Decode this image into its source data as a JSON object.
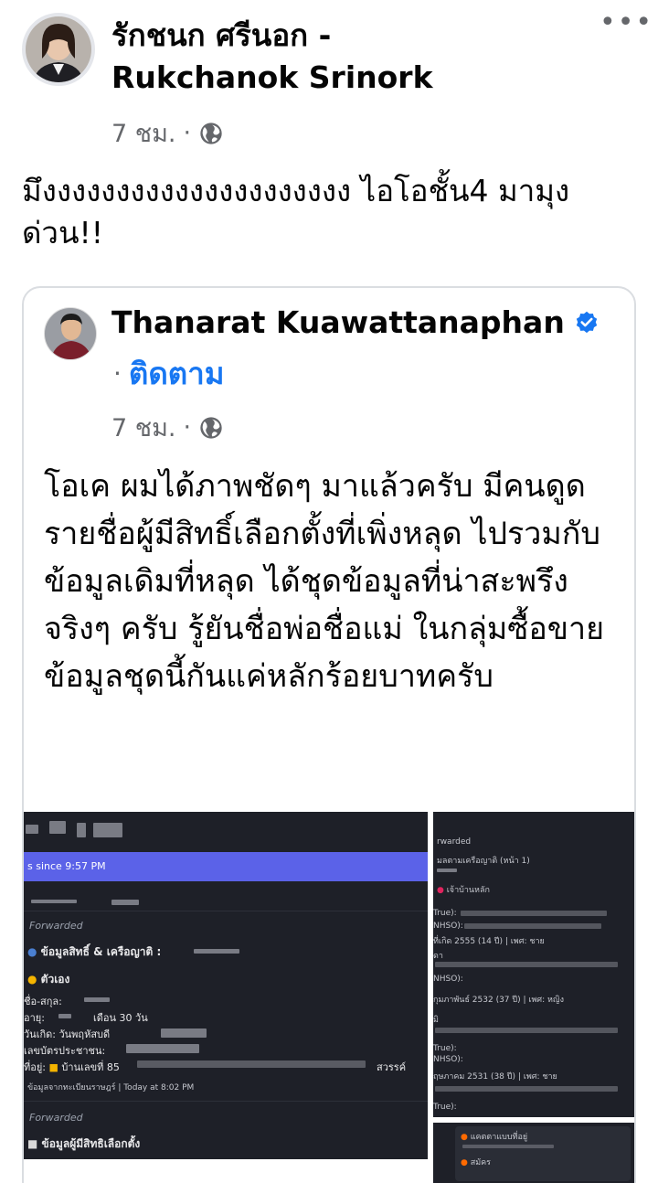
{
  "post": {
    "author": "รักชนก ศรีนอก - Rukchanok Srinork",
    "time": "7 ชม.",
    "text": "มึงงงงงงงงงงงงงงงงงงงงง ไอโอชั้น4 มามุงด่วน!!"
  },
  "shared": {
    "author": "Thanarat Kuawattanaphan",
    "follow_label": "ติดตาม",
    "time": "7 ชม.",
    "text": "โอเค ผมได้ภาพชัดๆ มาแล้วครับ มีคนดูดรายชื่อผู้มีสิทธิ์เลือกตั้งที่เพิ่งหลุด ไปรวมกับข้อมูลเดิมที่หลุด ได้ชุดข้อมูลที่น่าสะพรึงจริงๆ ครับ รู้ยันชื่อพ่อชื่อแม่ ในกลุ่มซื้อขายข้อมูลชุดนี้กันแค่หลักร้อยบาทครับ"
  },
  "screenshot_left": {
    "banner": "s since 9:57 PM",
    "forwarded": "Forwarded",
    "heading1": "ข้อมูลสิทธิ์ & เครือญาติ :",
    "self_label": "ตัวเอง",
    "name_label": "ชื่อ-สกุล:",
    "age_label": "อายุ:",
    "age_value": "เดือน 30 วัน",
    "birth_label": "วันเกิด: วันพฤหัสบดี",
    "id_label": "เลขบัตรประชาชน:",
    "address_label": "ที่อยู่:",
    "address_value": "บ้านเลขที่ 85",
    "address_tail": "สวรรค์",
    "footer": "ข้อมูลจากทะเบียนราษฎร์ | Today at 8:02 PM",
    "forwarded2": "Forwarded",
    "heading2": "ข้อมูลผู้มีสิทธิเลือกตั้ง"
  },
  "screenshot_right": {
    "forwarded": "rwarded",
    "heading": "มลตามเครือญาติ (หน้า 1)",
    "section": "เจ้าบ้านหลัก",
    "line_true": "True):",
    "line_nhso": "NHSO):",
    "line_birth1": "ที่เกิด 2555 (14 ปี) | เพศ: ชาย",
    "line_a": "ดา",
    "line_birth2": "กุมภาพันธ์ 2532 (37 ปี) | เพศ: หญิง",
    "line_b": "มิ",
    "line_birth3": "ฤษภาคม 2531 (38 ปี) | เพศ: ชาย",
    "box_line1": "แคตตาแบบที่อยู่",
    "box_line2": "สมัคร"
  }
}
